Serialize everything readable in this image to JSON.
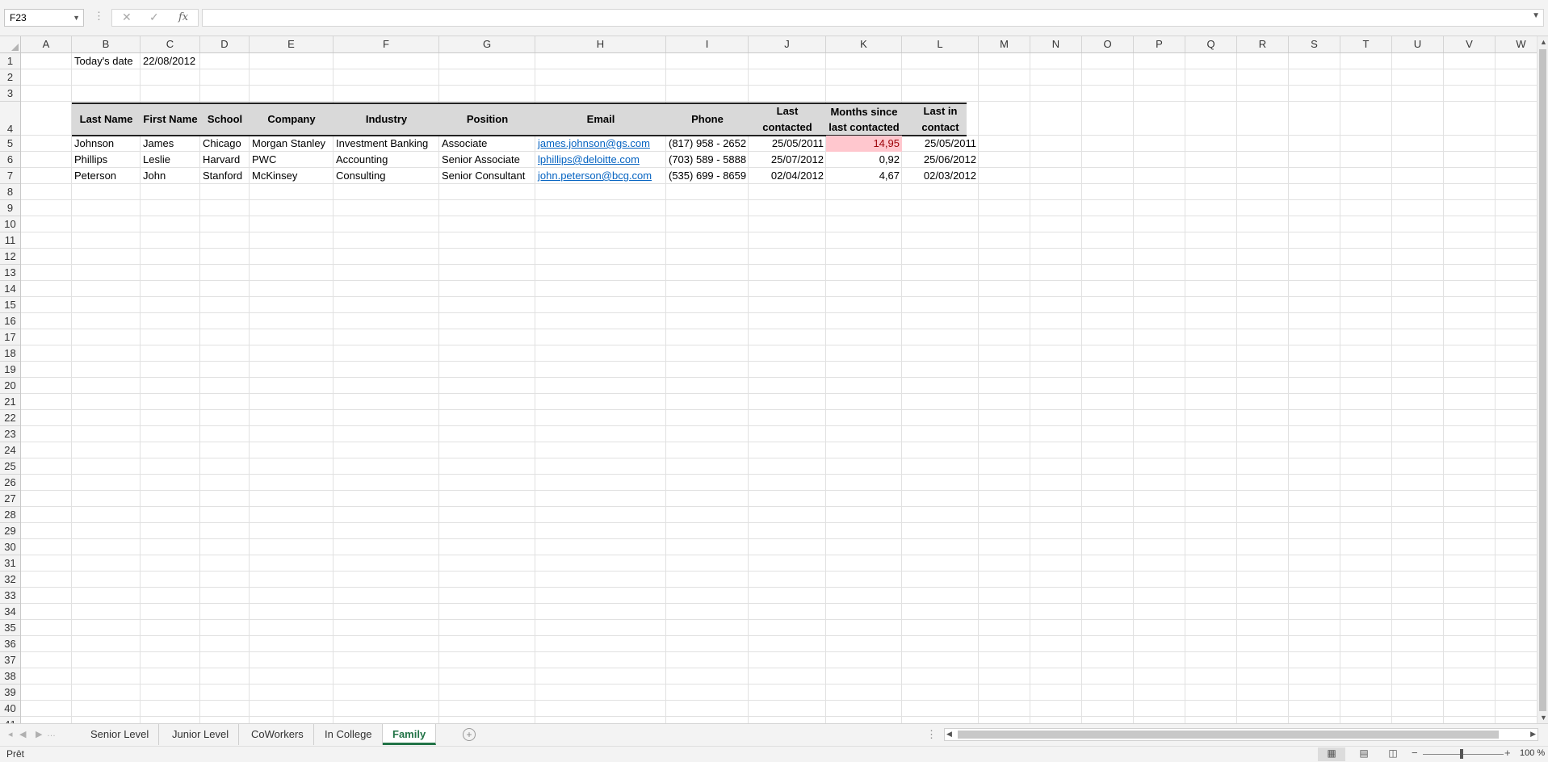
{
  "formula_bar": {
    "name_box": "F23",
    "cancel_icon": "✕",
    "enter_icon": "✓",
    "fx_label": "fx",
    "formula": ""
  },
  "columns": [
    "A",
    "B",
    "C",
    "D",
    "E",
    "F",
    "G",
    "H",
    "I",
    "J",
    "K",
    "L",
    "M",
    "N",
    "O",
    "P",
    "Q",
    "R",
    "S",
    "T",
    "U",
    "V",
    "W"
  ],
  "rows": [
    "1",
    "2",
    "3",
    "4",
    "5",
    "6",
    "7",
    "8",
    "9",
    "10",
    "11",
    "12",
    "13",
    "14",
    "15",
    "16",
    "17",
    "18",
    "19",
    "20",
    "21",
    "22",
    "23",
    "24",
    "25",
    "26",
    "27",
    "28",
    "29",
    "30",
    "31",
    "32",
    "33",
    "34",
    "35",
    "36",
    "37",
    "38",
    "39",
    "40",
    "41"
  ],
  "sheet": {
    "today_label": "Today's date",
    "today_value": "22/08/2012",
    "headers": {
      "last_name": "Last Name",
      "first_name": "First Name",
      "school": "School",
      "company": "Company",
      "industry": "Industry",
      "position": "Position",
      "email": "Email",
      "phone": "Phone",
      "last_contacted": "Last contacted",
      "months_since": "Months since last contacted",
      "last_in_contact": "Last in contact"
    },
    "records": [
      {
        "last_name": "Johnson",
        "first_name": "James",
        "school": "Chicago",
        "company": "Morgan Stanley",
        "industry": "Investment Banking",
        "position": "Associate",
        "email": "james.johnson@gs.com",
        "phone": "(817) 958 - 2652",
        "last_contacted": "25/05/2011",
        "months_since": "14,95",
        "last_in_contact": "25/05/2011"
      },
      {
        "last_name": "Phillips",
        "first_name": "Leslie",
        "school": "Harvard",
        "company": "PWC",
        "industry": "Accounting",
        "position": "Senior Associate",
        "email": "lphillips@deloitte.com",
        "phone": "(703) 589 - 5888",
        "last_contacted": "25/07/2012",
        "months_since": "0,92",
        "last_in_contact": "25/06/2012"
      },
      {
        "last_name": "Peterson",
        "first_name": "John",
        "school": "Stanford",
        "company": "McKinsey",
        "industry": "Consulting",
        "position": "Senior Consultant",
        "email": "john.peterson@bcg.com",
        "phone": "(535) 699 - 8659",
        "last_contacted": "02/04/2012",
        "months_since": "4,67",
        "last_in_contact": "02/03/2012"
      }
    ],
    "highlight_color": "#ffc7ce"
  },
  "tabs": {
    "items": [
      "Senior Level",
      "Junior Level",
      "CoWorkers",
      "In College",
      "Family"
    ],
    "active": "Family",
    "accent_color": "#217346"
  },
  "status_bar": {
    "status": "Prêt",
    "zoom": "100 %"
  }
}
